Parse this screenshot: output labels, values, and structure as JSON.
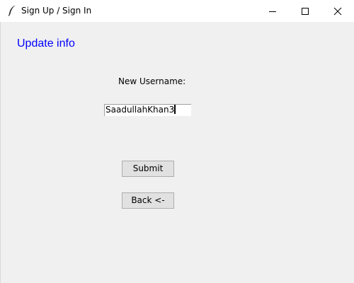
{
  "window": {
    "title": "Sign Up / Sign In",
    "controls": {
      "minimize_icon": "minimize-icon",
      "maximize_icon": "maximize-icon",
      "close_icon": "close-icon"
    }
  },
  "main": {
    "heading": "Update info",
    "username_label": "New Username:",
    "username_value": "SaadullahKhan3",
    "submit_label": "Submit",
    "back_label": "Back <-"
  },
  "colors": {
    "heading": "#0000ff",
    "background": "#f0f0f0",
    "titlebar": "#ffffff",
    "button_face": "#e1e1e1",
    "button_border": "#adadad"
  }
}
